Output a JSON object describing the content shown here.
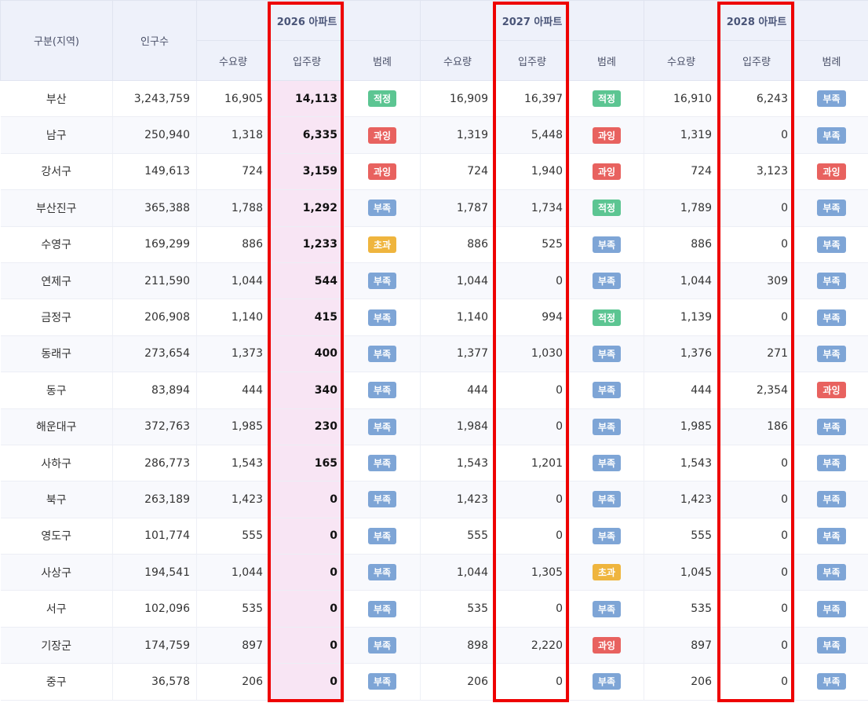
{
  "header": {
    "region": "구분(지역)",
    "population": "인구수",
    "years": [
      "2026 아파트",
      "2027 아파트",
      "2028 아파트"
    ],
    "demand": "수요량",
    "supply": "입주량",
    "legend": "범례"
  },
  "badge_colors": {
    "적정": "#5cc592",
    "과잉": "#e8625f",
    "부족": "#7ea5d6",
    "초과": "#efb53e"
  },
  "rows": [
    [
      "부산",
      "3,243,759",
      "16,905",
      "14,113",
      "적정",
      "16,909",
      "16,397",
      "적정",
      "16,910",
      "6,243",
      "부족"
    ],
    [
      "남구",
      "250,940",
      "1,318",
      "6,335",
      "과잉",
      "1,319",
      "5,448",
      "과잉",
      "1,319",
      "0",
      "부족"
    ],
    [
      "강서구",
      "149,613",
      "724",
      "3,159",
      "과잉",
      "724",
      "1,940",
      "과잉",
      "724",
      "3,123",
      "과잉"
    ],
    [
      "부산진구",
      "365,388",
      "1,788",
      "1,292",
      "부족",
      "1,787",
      "1,734",
      "적정",
      "1,789",
      "0",
      "부족"
    ],
    [
      "수영구",
      "169,299",
      "886",
      "1,233",
      "초과",
      "886",
      "525",
      "부족",
      "886",
      "0",
      "부족"
    ],
    [
      "연제구",
      "211,590",
      "1,044",
      "544",
      "부족",
      "1,044",
      "0",
      "부족",
      "1,044",
      "309",
      "부족"
    ],
    [
      "금정구",
      "206,908",
      "1,140",
      "415",
      "부족",
      "1,140",
      "994",
      "적정",
      "1,139",
      "0",
      "부족"
    ],
    [
      "동래구",
      "273,654",
      "1,373",
      "400",
      "부족",
      "1,377",
      "1,030",
      "부족",
      "1,376",
      "271",
      "부족"
    ],
    [
      "동구",
      "83,894",
      "444",
      "340",
      "부족",
      "444",
      "0",
      "부족",
      "444",
      "2,354",
      "과잉"
    ],
    [
      "해운대구",
      "372,763",
      "1,985",
      "230",
      "부족",
      "1,984",
      "0",
      "부족",
      "1,985",
      "186",
      "부족"
    ],
    [
      "사하구",
      "286,773",
      "1,543",
      "165",
      "부족",
      "1,543",
      "1,201",
      "부족",
      "1,543",
      "0",
      "부족"
    ],
    [
      "북구",
      "263,189",
      "1,423",
      "0",
      "부족",
      "1,423",
      "0",
      "부족",
      "1,423",
      "0",
      "부족"
    ],
    [
      "영도구",
      "101,774",
      "555",
      "0",
      "부족",
      "555",
      "0",
      "부족",
      "555",
      "0",
      "부족"
    ],
    [
      "사상구",
      "194,541",
      "1,044",
      "0",
      "부족",
      "1,044",
      "1,305",
      "초과",
      "1,045",
      "0",
      "부족"
    ],
    [
      "서구",
      "102,096",
      "535",
      "0",
      "부족",
      "535",
      "0",
      "부족",
      "535",
      "0",
      "부족"
    ],
    [
      "기장군",
      "174,759",
      "897",
      "0",
      "부족",
      "898",
      "2,220",
      "과잉",
      "897",
      "0",
      "부족"
    ],
    [
      "중구",
      "36,578",
      "206",
      "0",
      "부족",
      "206",
      "0",
      "부족",
      "206",
      "0",
      "부족"
    ]
  ]
}
